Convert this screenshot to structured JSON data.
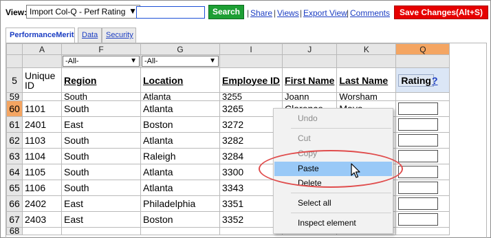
{
  "toolbar": {
    "view_label": "View:",
    "view_value": "Import Col-Q - Perf Rating",
    "search_value": "",
    "search_label": "Search",
    "links": [
      "Share",
      "Views",
      "Export View",
      "Comments"
    ],
    "save_label": "Save Changes(Alt+S)"
  },
  "tabs": [
    "PerformanceMerit",
    "Data",
    "Security"
  ],
  "grid": {
    "col_letters": [
      "A",
      "F",
      "G",
      "I",
      "J",
      "K",
      "Q"
    ],
    "filter_value": "-All-",
    "header_rownum": "5",
    "headers": [
      "Unique ID",
      "Region",
      "Location",
      "Employee ID",
      "First Name",
      "Last Name",
      "Rating"
    ],
    "help": "?",
    "partial_top": {
      "rownum": "59",
      "region": "South",
      "location": "Atlanta",
      "employee_id": "3255",
      "first": "Joann",
      "last": "Worsham"
    },
    "rows": [
      {
        "rownum": "60",
        "uid": "1101",
        "region": "South",
        "location": "Atlanta",
        "emp": "3265",
        "first": "Clarence",
        "last": "Maya"
      },
      {
        "rownum": "61",
        "uid": "2401",
        "region": "East",
        "location": "Boston",
        "emp": "3272",
        "first": "",
        "last": ""
      },
      {
        "rownum": "62",
        "uid": "1103",
        "region": "South",
        "location": "Atlanta",
        "emp": "3282",
        "first": "",
        "last": ""
      },
      {
        "rownum": "63",
        "uid": "1104",
        "region": "South",
        "location": "Raleigh",
        "emp": "3284",
        "first": "",
        "last": ""
      },
      {
        "rownum": "64",
        "uid": "1105",
        "region": "South",
        "location": "Atlanta",
        "emp": "3300",
        "first": "",
        "last": ""
      },
      {
        "rownum": "65",
        "uid": "1106",
        "region": "South",
        "location": "Atlanta",
        "emp": "3343",
        "first": "",
        "last": ""
      },
      {
        "rownum": "66",
        "uid": "2402",
        "region": "East",
        "location": "Philadelphia",
        "emp": "3351",
        "first": "",
        "last": ""
      },
      {
        "rownum": "67",
        "uid": "2403",
        "region": "East",
        "location": "Boston",
        "emp": "3352",
        "first": "",
        "last": ""
      }
    ],
    "partial_bottom_rownum": "68"
  },
  "context_menu": {
    "undo": "Undo",
    "cut": "Cut",
    "copy": "Copy",
    "paste": "Paste",
    "delete": "Delete",
    "select_all": "Select all",
    "inspect": "Inspect element"
  },
  "colors": {
    "save": "#e60000",
    "search": "#1d9f34",
    "selected_col": "#f4a562",
    "highlight": "#99c9f7",
    "annotation": "#e04c4c"
  },
  "icons": [
    "dropdown-arrow-icon",
    "mouse-pointer-icon",
    "help-icon"
  ]
}
